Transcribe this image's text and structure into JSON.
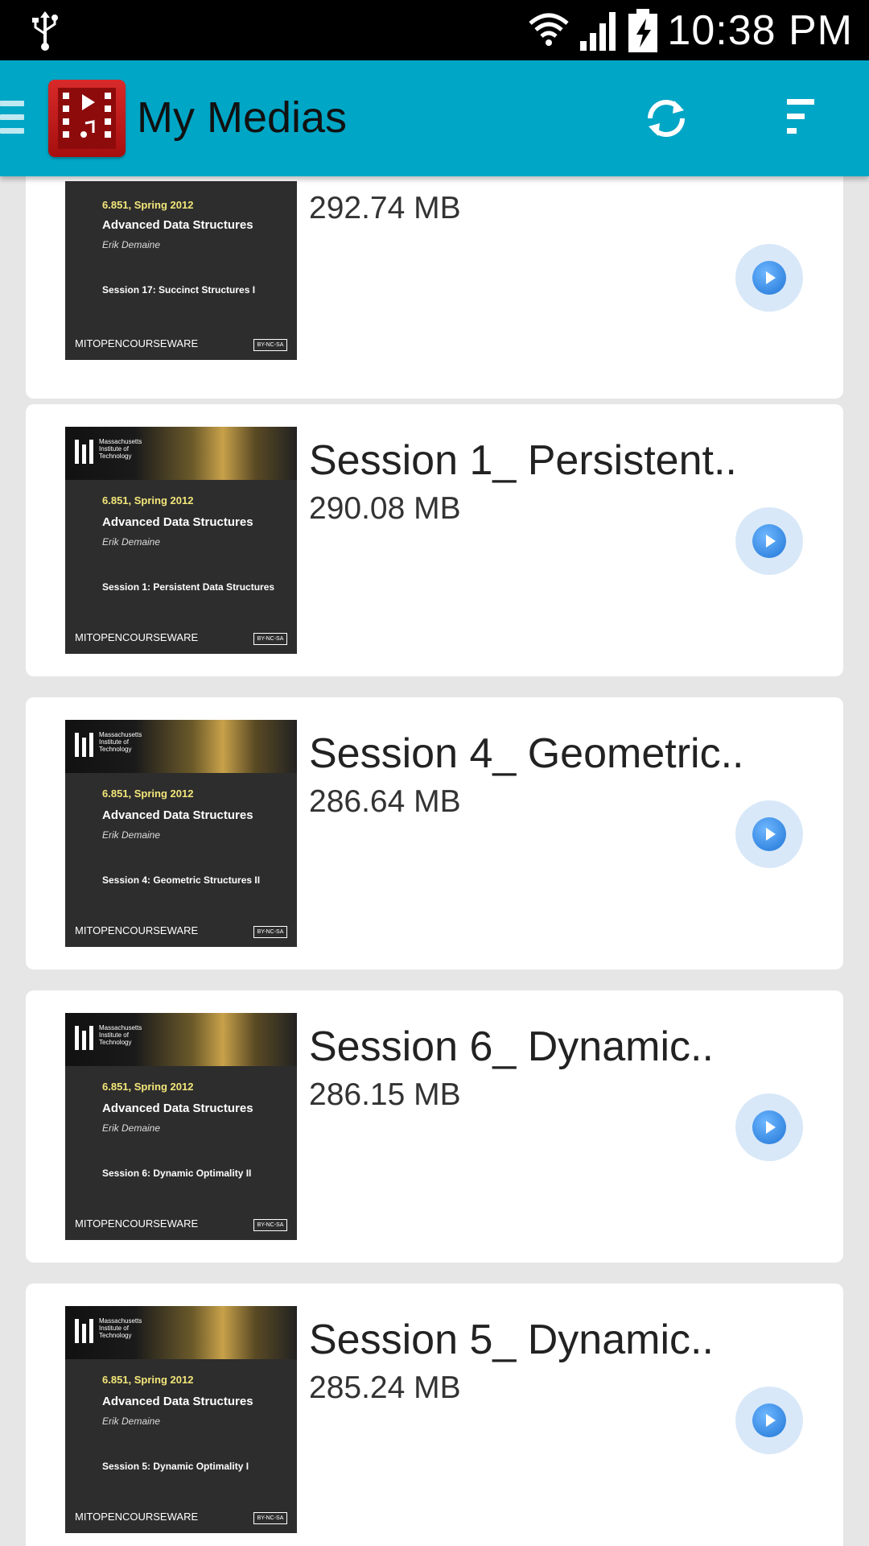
{
  "status": {
    "time": "10:38 PM"
  },
  "appbar": {
    "title": "My Medias"
  },
  "thumbnail": {
    "institution": "Massachusetts Institute of Technology",
    "course": "6.851, Spring 2012",
    "course_name": "Advanced Data Structures",
    "author": "Erik Demaine",
    "ocw": "MITOPENCOURSEWARE",
    "license": "BY-NC-SA"
  },
  "items": [
    {
      "title": "",
      "size": "292.74 MB",
      "session": "Session 17:  Succinct Structures I"
    },
    {
      "title": "Session 1_ Persistent..",
      "size": "290.08 MB",
      "session": "Session 1:  Persistent Data Structures"
    },
    {
      "title": "Session 4_ Geometric..",
      "size": "286.64 MB",
      "session": "Session 4:  Geometric Structures II"
    },
    {
      "title": "Session 6_ Dynamic..",
      "size": "286.15 MB",
      "session": "Session 6:  Dynamic Optimality II"
    },
    {
      "title": "Session 5_ Dynamic..",
      "size": "285.24 MB",
      "session": "Session 5:  Dynamic Optimality I"
    }
  ],
  "colors": {
    "appbar": "#00a6c6",
    "background": "#e6e6e6",
    "card": "#ffffff"
  },
  "icons": [
    "usb-icon",
    "wifi-icon",
    "signal-icon",
    "battery-icon",
    "menu-icon",
    "app-logo-icon",
    "refresh-icon",
    "sort-icon",
    "play-icon"
  ]
}
